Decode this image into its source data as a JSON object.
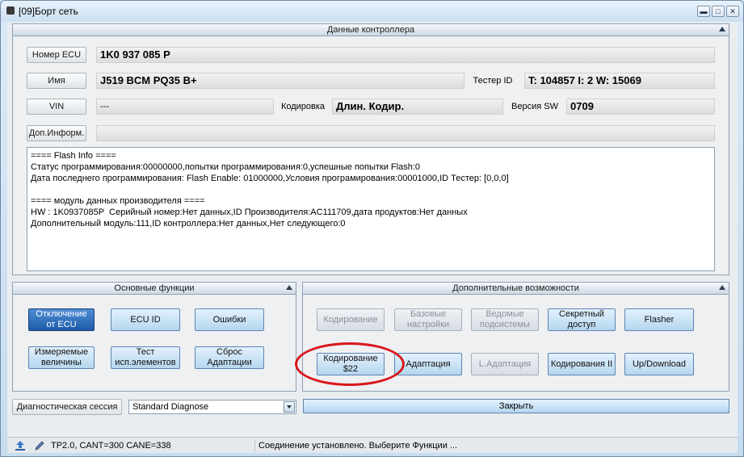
{
  "window": {
    "title": "[09]Борт сеть",
    "minimize_glyph": "▬",
    "maximize_glyph": "□",
    "close_glyph": "✕"
  },
  "controller": {
    "header": "Данные контроллера",
    "ecu_number_label": "Номер ECU",
    "ecu_number_value": "1K0 937 085 P",
    "name_label": "Имя",
    "name_value": "J519 BCM PQ35  B+",
    "tester_id_label": "Тестер ID",
    "tester_id_value": "T: 104857 I: 2 W: 15069",
    "vin_label": "VIN",
    "vin_value": "---",
    "coding_label": "Кодировка",
    "coding_value": "Длин. Кодир.",
    "sw_version_label": "Версия SW",
    "sw_version_value": "0709",
    "extra_info_label": "Доп.Информ.",
    "extra_info_value": "",
    "info_text": "==== Flash Info ====\nСтатус программирования:00000000,попытки программирования:0,успешные попытки Flash:0\nДата последнего программирования: Flash Enable: 01000000,Условия програмирования:00001000,ID Тестер: [0,0,0]\n\n==== модуль данных производителя ====\nHW : 1K0937085P  Серийный номер:Нет данных,ID Производителя:AC111709,дата продуктов:Нет данных\nДополнительный модуль:111,ID контроллера:Нет данных,Нет следующего:0"
  },
  "basic_functions": {
    "header": "Основные функции",
    "disconnect": "Отключение от ECU",
    "ecu_id": "ECU ID",
    "errors": "Ошибки",
    "measured_values": "Измеряемые величины",
    "output_test": "Тест исп.элементов",
    "reset_adaptation": "Сброс Адаптации"
  },
  "extra_functions": {
    "header": "Дополнительные возможности",
    "coding": "Кодирование",
    "basic_settings": "Базовые настройки",
    "subsystems": "Ведомые подсистемы",
    "secret_access": "Секретный доступ",
    "flasher": "Flasher",
    "coding_22": "Кодирование $22",
    "adaptation": "Адаптация",
    "l_adaptation": "L.Адаптация",
    "coding_2": "Кодирования II",
    "updown": "Up/Download"
  },
  "session": {
    "label": "Диагностическая сессия",
    "value": "Standard Diagnose"
  },
  "close_label": "Закрыть",
  "status": {
    "protocol": "TP2.0, CANT=300 CANE=338",
    "message": "Соединение установлено. Выберите Функции ..."
  },
  "icons": {
    "upload": "upload-icon",
    "pen": "pen-icon"
  },
  "colors": {
    "highlight": "#d9161b",
    "active_button": "#1e5aa8"
  }
}
